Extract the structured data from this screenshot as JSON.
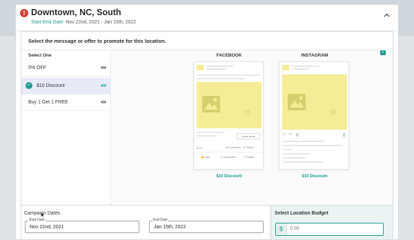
{
  "location": {
    "title": "Downtown, NC, South",
    "date_label": "Start-End Date:",
    "date_range": "Nov 22nd, 2021 - Jan 15th, 2022"
  },
  "main": {
    "prompt": "Select the message or offer to promote for this location.",
    "list_title": "Select One",
    "offers": [
      {
        "label": "5% OFF"
      },
      {
        "label": "$10 Discount",
        "selected": true
      },
      {
        "label": "Buy 1 Get 1 FREE"
      }
    ]
  },
  "preview": {
    "facebook_title": "FACEBOOK",
    "instagram_title": "INSTAGRAM",
    "facebook_caption": "$10 Discount",
    "instagram_caption": "$10 Discount",
    "fb_like": "Like",
    "fb_comment": "Comment",
    "fb_share": "Share",
    "fb_cta": "LEARN MORE",
    "fb_count": "24",
    "fb_comments": "86 Comments · 21 Shares"
  },
  "campaign": {
    "title": "Campaign Dates",
    "start_label": "Start Date",
    "start_value": "Nov 22nd, 2021",
    "end_label": "End Date",
    "end_value": "Jan 15th, 2022"
  },
  "budget": {
    "title": "Select Location Budget",
    "currency": "$",
    "placeholder": "0.00"
  },
  "colors": {
    "accent": "#1e9a8d",
    "alert": "#d9423a",
    "selected_bg": "#e7ebf8",
    "placeholder_yellow": "#f5ec96"
  },
  "icons": [
    "alert-icon",
    "chevron-up-icon",
    "eye-icon",
    "check-circle-icon",
    "chat-icon",
    "mouse-cursor-icon"
  ]
}
